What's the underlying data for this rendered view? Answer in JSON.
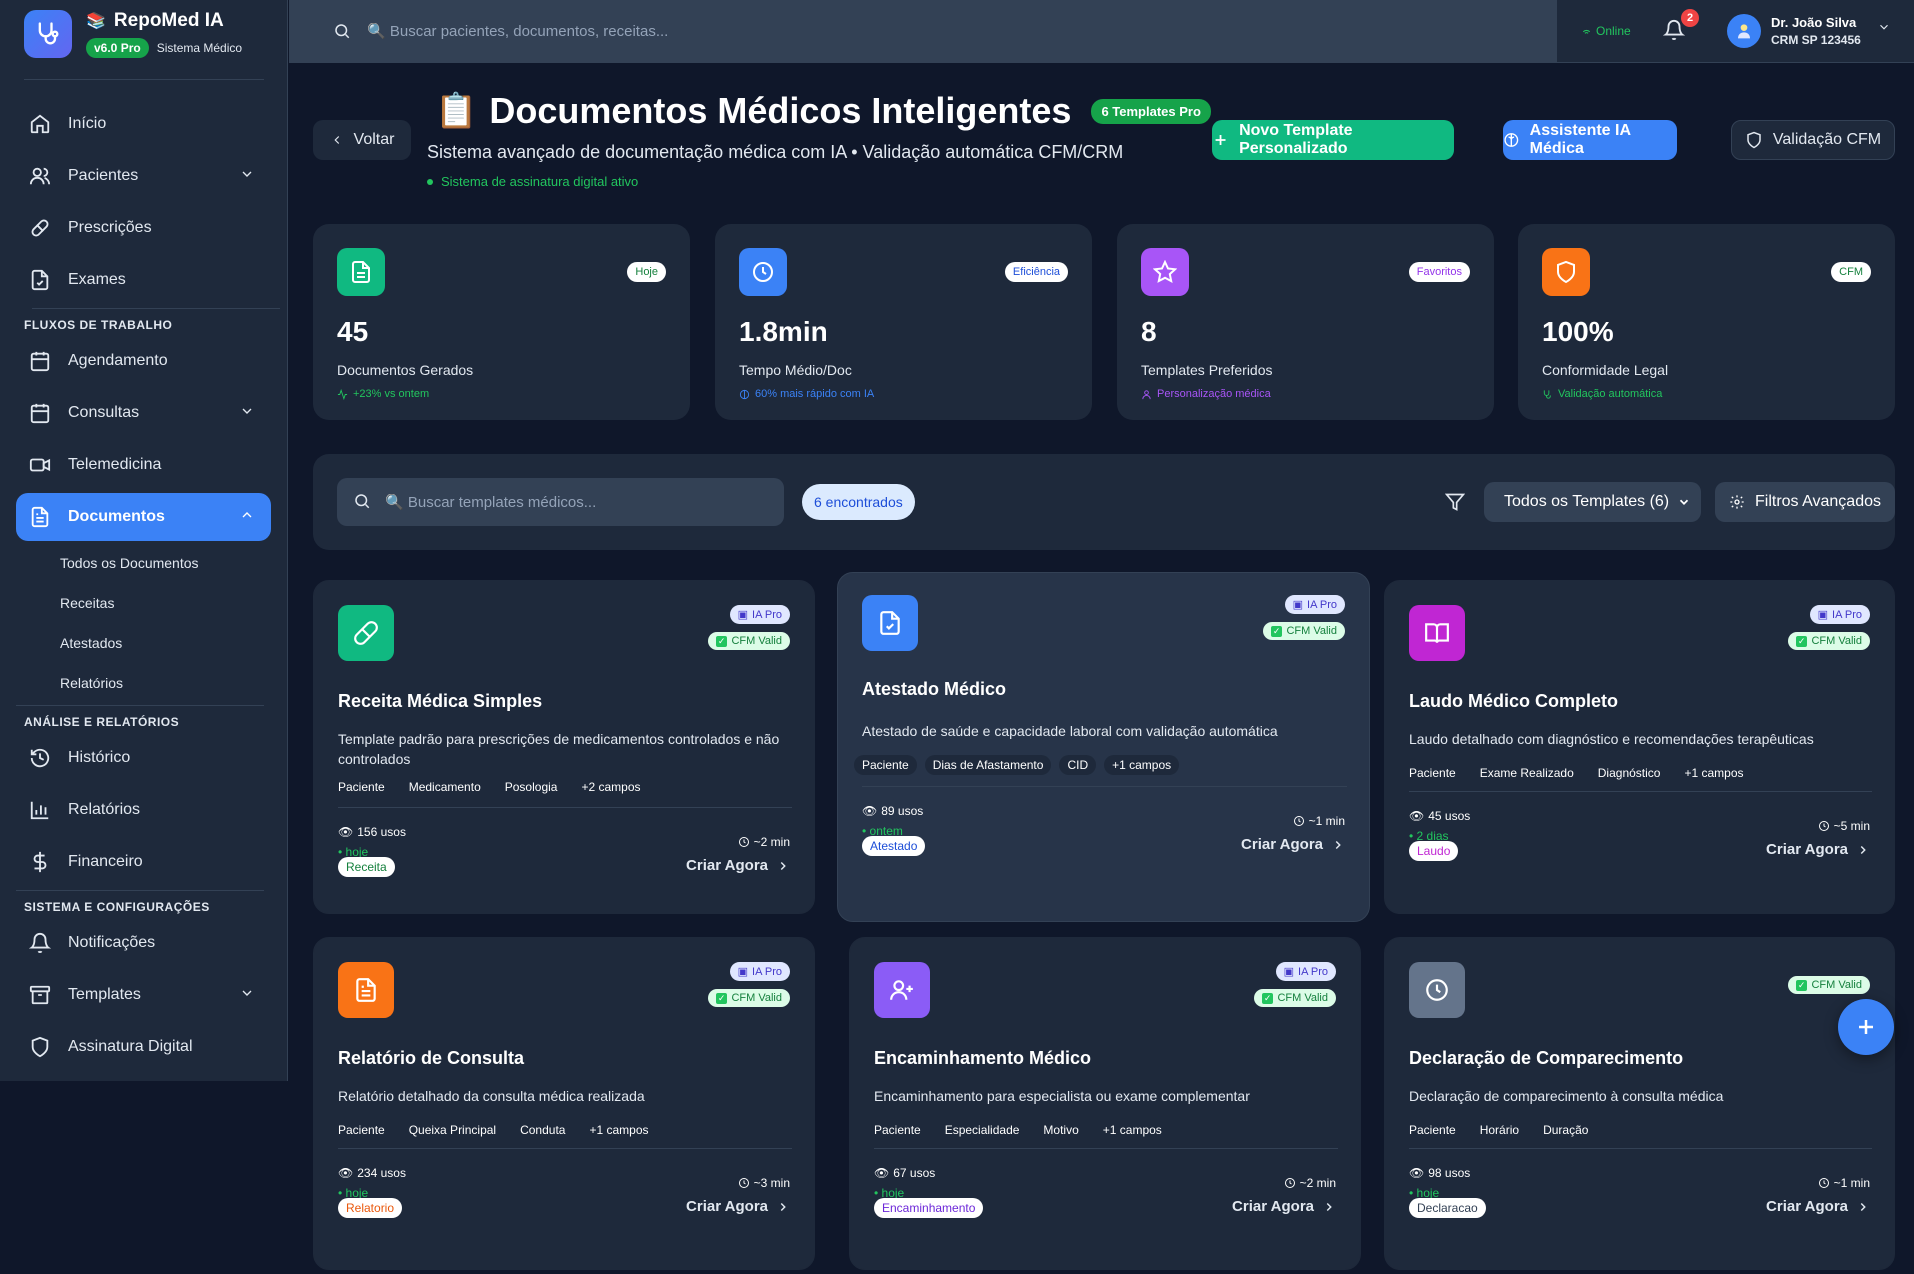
{
  "brand": {
    "name": "RepoMed IA",
    "emoji": "📚",
    "version": "v6.0 Pro",
    "subtitle": "Sistema Médico"
  },
  "sidebar": {
    "items": [
      {
        "label": "Início",
        "icon": "home-icon"
      },
      {
        "label": "Pacientes",
        "icon": "users-icon"
      },
      {
        "label": "Prescrições",
        "icon": "pill-icon"
      },
      {
        "label": "Exames",
        "icon": "file-check-icon"
      },
      {
        "label": "Agendamento",
        "icon": "calendar-icon"
      },
      {
        "label": "Consultas",
        "icon": "calendar-icon"
      },
      {
        "label": "Telemedicina",
        "icon": "video-icon"
      },
      {
        "label": "Documentos",
        "icon": "file-text-icon"
      },
      {
        "label": "Histórico",
        "icon": "history-icon"
      },
      {
        "label": "Relatórios",
        "icon": "bar-chart-icon"
      },
      {
        "label": "Financeiro",
        "icon": "dollar-icon"
      },
      {
        "label": "Notificações",
        "icon": "bell-icon"
      },
      {
        "label": "Templates",
        "icon": "archive-icon"
      },
      {
        "label": "Assinatura Digital",
        "icon": "shield-icon"
      }
    ],
    "sections": [
      "FLUXOS DE TRABALHO",
      "ANÁLISE E RELATÓRIOS",
      "SISTEMA E CONFIGURAÇÕES"
    ],
    "documentos_sub": [
      "Todos os Documentos",
      "Receitas",
      "Atestados",
      "Relatórios"
    ]
  },
  "topbar": {
    "search_placeholder": "🔍 Buscar pacientes, documentos, receitas...",
    "status": "Online",
    "notifications_count": "2",
    "user_name": "Dr. João Silva",
    "user_crm": "CRM SP 123456"
  },
  "header": {
    "back_label": "Voltar",
    "emoji": "📋",
    "title": "Documentos Médicos Inteligentes",
    "title_badge": "6 Templates Pro",
    "subtitle": "Sistema avançado de documentação médica com IA • Validação automática CFM/CRM",
    "signature_status": "Sistema de assinatura digital ativo",
    "new_template_label": "Novo Template Personalizado",
    "ai_assistant_label": "Assistente IA Médica",
    "cfm_validation_label": "Validação CFM"
  },
  "stats": [
    {
      "value": "45",
      "label": "Documentos Gerados",
      "badge": "Hoje",
      "note": "+23% vs ontem",
      "color": "#10b981",
      "badge_color": "#15803d",
      "note_color": "#22c55e"
    },
    {
      "value": "1.8min",
      "label": "Tempo Médio/Doc",
      "badge": "Eficiência",
      "note": "60% mais rápido com IA",
      "color": "#3b82f6",
      "badge_color": "#1d4ed8",
      "note_color": "#3b82f6"
    },
    {
      "value": "8",
      "label": "Templates Preferidos",
      "badge": "Favoritos",
      "note": "Personalização médica",
      "color": "#a855f7",
      "badge_color": "#9333ea",
      "note_color": "#a855f7"
    },
    {
      "value": "100%",
      "label": "Conformidade Legal",
      "badge": "CFM",
      "note": "Validação automática",
      "color": "#f97316",
      "badge_color": "#15803d",
      "note_color": "#22c55e"
    }
  ],
  "filters": {
    "search_placeholder": "🔍 Buscar templates médicos...",
    "count": "6 encontrados",
    "select_value": "Todos os Templates (6)",
    "advanced_label": "Filtros Avançados"
  },
  "badges": {
    "ia": "IA Pro",
    "cfm": "CFM Valid",
    "cta": "Criar Agora"
  },
  "templates": [
    {
      "title": "Receita Médica Simples",
      "desc": "Template padrão para prescrições de medicamentos controlados e não controlados",
      "fields": [
        "Paciente",
        "Medicamento",
        "Posologia",
        "+2 campos"
      ],
      "uses": "156 usos",
      "when": "• hoje",
      "time": "~2 min",
      "tag": "Receita",
      "tag_color": "#15803d",
      "icon": "pill-icon",
      "color": "#10b981"
    },
    {
      "title": "Atestado Médico",
      "desc": "Atestado de saúde e capacidade laboral com validação automática",
      "fields": [
        "Paciente",
        "Dias de Afastamento",
        "CID",
        "+1 campos"
      ],
      "uses": "89 usos",
      "when": "• ontem",
      "time": "~1 min",
      "tag": "Atestado",
      "tag_color": "#1d4ed8",
      "icon": "file-check-icon",
      "color": "#3b82f6"
    },
    {
      "title": "Laudo Médico Completo",
      "desc": "Laudo detalhado com diagnóstico e recomendações terapêuticas",
      "fields": [
        "Paciente",
        "Exame Realizado",
        "Diagnóstico",
        "+1 campos"
      ],
      "uses": "45 usos",
      "when": "• 2 dias",
      "time": "~5 min",
      "tag": "Laudo",
      "tag_color": "#c026d3",
      "icon": "book-icon",
      "color": "#c026d3"
    },
    {
      "title": "Relatório de Consulta",
      "desc": "Relatório detalhado da consulta médica realizada",
      "fields": [
        "Paciente",
        "Queixa Principal",
        "Conduta",
        "+1 campos"
      ],
      "uses": "234 usos",
      "when": "• hoje",
      "time": "~3 min",
      "tag": "Relatorio",
      "tag_color": "#ea580c",
      "icon": "file-text-icon",
      "color": "#f97316"
    },
    {
      "title": "Encaminhamento Médico",
      "desc": "Encaminhamento para especialista ou exame complementar",
      "fields": [
        "Paciente",
        "Especialidade",
        "Motivo",
        "+1 campos"
      ],
      "uses": "67 usos",
      "when": "• hoje",
      "time": "~2 min",
      "tag": "Encaminhamento",
      "tag_color": "#6d28d9",
      "icon": "user-plus-icon",
      "color": "#8b5cf6"
    },
    {
      "title": "Declaração de Comparecimento",
      "desc": "Declaração de comparecimento à consulta médica",
      "fields": [
        "Paciente",
        "Horário",
        "Duração"
      ],
      "uses": "98 usos",
      "when": "• hoje",
      "time": "~1 min",
      "tag": "Declaracao",
      "tag_color": "#334155",
      "icon": "clock-icon",
      "color": "#64748b"
    }
  ]
}
